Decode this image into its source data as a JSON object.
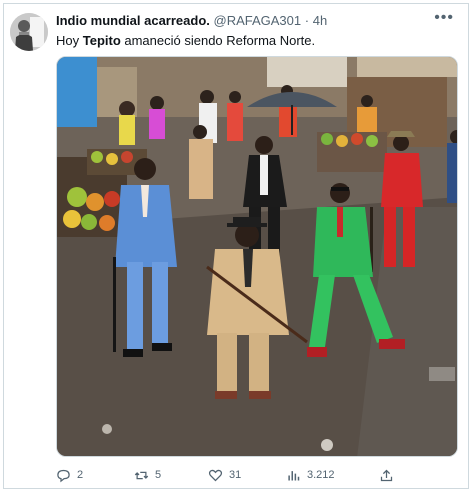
{
  "tweet": {
    "author_name": "Indio mundial acarreado.",
    "handle": "@RAFAGA301",
    "separator": "·",
    "time": "4h",
    "text_before": "Hoy ",
    "text_bold": "Tepito",
    "text_after": " amaneció siendo Reforma Norte.",
    "more_icon": "more-dots-icon"
  },
  "actions": {
    "replies": "2",
    "retweets": "5",
    "likes": "31",
    "views": "3.212"
  },
  "icons": {
    "reply": "reply-icon",
    "retweet": "retweet-icon",
    "like": "heart-icon",
    "views": "views-bar-chart-icon",
    "share": "share-icon"
  },
  "colors": {
    "text": "#0f1419",
    "muted": "#536471",
    "border": "#cfd9de",
    "suit_blue": "#5b8fd6",
    "suit_beige": "#d9b98a",
    "suit_green": "#2fb85a",
    "suit_red": "#d8282a"
  }
}
